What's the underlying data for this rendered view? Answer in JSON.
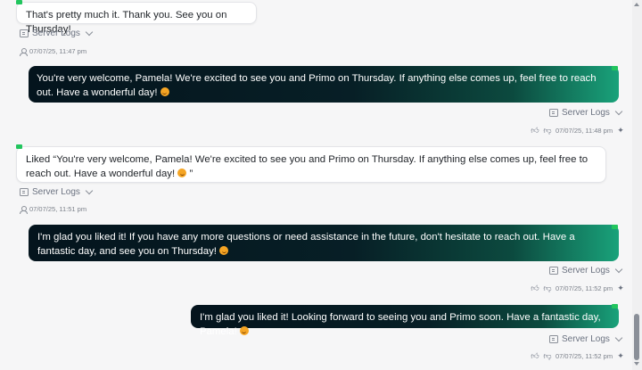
{
  "server_logs_label": "Server Logs",
  "messages": [
    {
      "role": "user",
      "text": "That's pretty much it. Thank you. See you on Thursday!",
      "timestamp": "07/07/25, 11:47 pm"
    },
    {
      "role": "agent",
      "text": "You're very welcome, Pamela! We're excited to see you and Primo on Thursday. If anything else comes up, feel free to reach out. Have a wonderful day!",
      "timestamp": "07/07/25, 11:48 pm"
    },
    {
      "role": "user",
      "text": "Liked “You're very welcome, Pamela! We're excited to see you and Primo on Thursday. If anything else comes up, feel free to reach out. Have a wonderful day! ",
      "text_end": "”",
      "timestamp": "07/07/25, 11:51 pm"
    },
    {
      "role": "agent",
      "text": "I'm glad you liked it! If you have any more questions or need assistance in the future, don't hesitate to reach out. Have a fantastic day, and see you on Thursday!",
      "timestamp": "07/07/25, 11:52 pm"
    },
    {
      "role": "agent",
      "text": "I'm glad you liked it! Looking forward to seeing you and Primo soon. Have a fantastic day, Pamela!",
      "timestamp": "07/07/25, 11:52 pm"
    }
  ],
  "colors": {
    "flag": "#22c55e",
    "bubble_out_start": "#04141d",
    "bubble_out_end": "#19a27a"
  }
}
